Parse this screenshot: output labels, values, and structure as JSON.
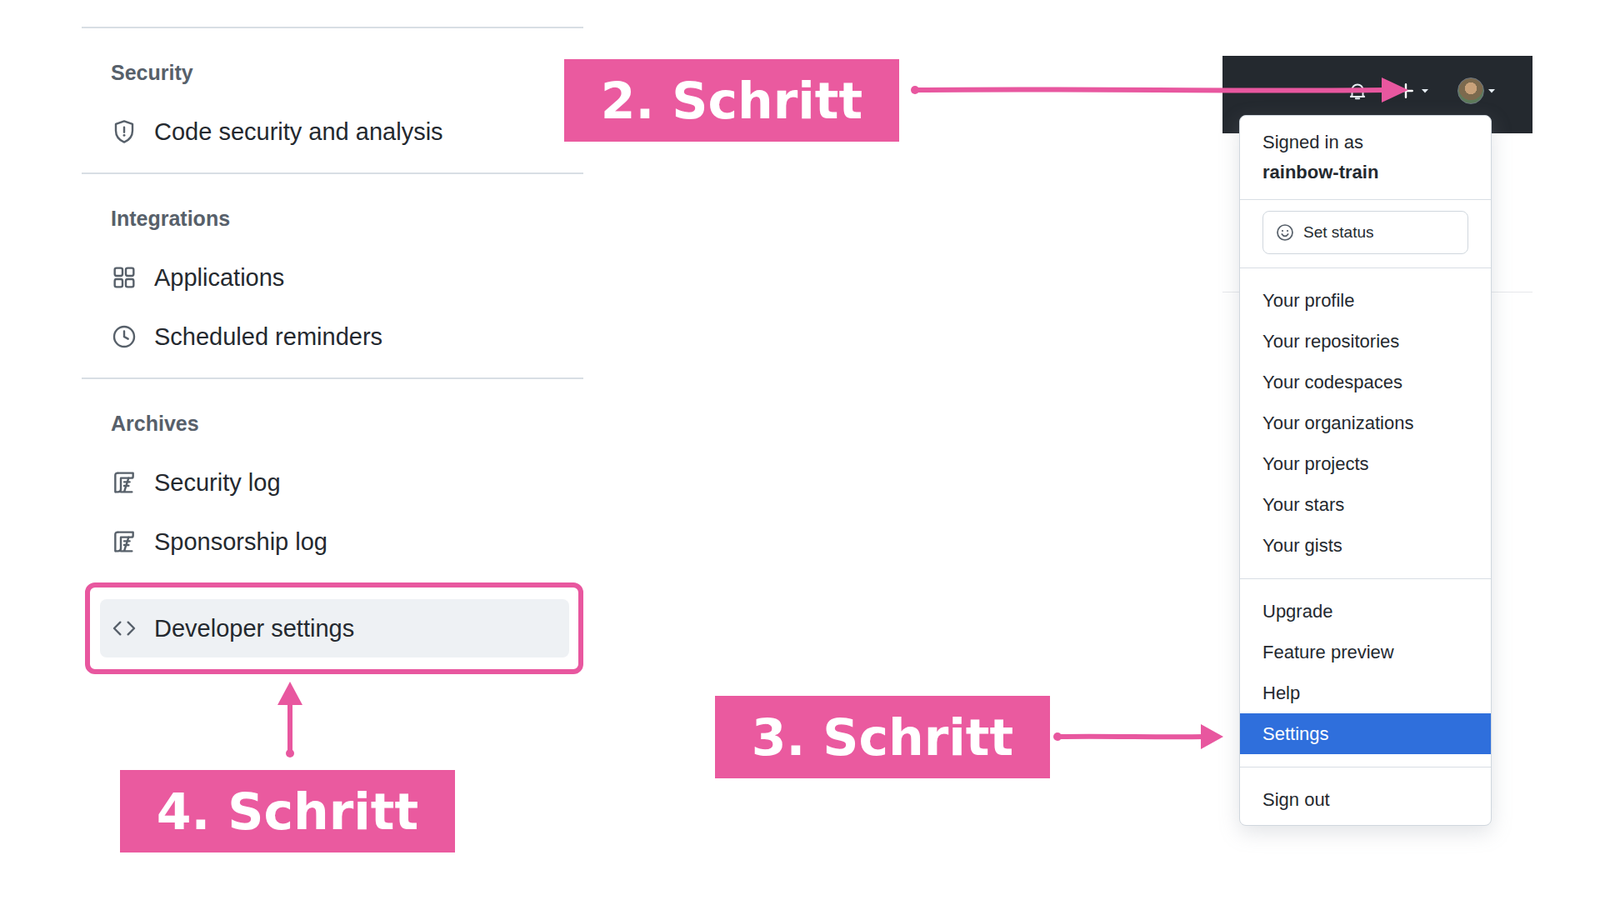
{
  "sidebar": {
    "sections": [
      {
        "heading": "Security",
        "items": [
          {
            "label": "Code security and analysis",
            "selected": false
          }
        ]
      },
      {
        "heading": "Integrations",
        "items": [
          {
            "label": "Applications",
            "selected": false
          },
          {
            "label": "Scheduled reminders",
            "selected": false
          }
        ]
      },
      {
        "heading": "Archives",
        "items": [
          {
            "label": "Security log",
            "selected": false
          },
          {
            "label": "Sponsorship log",
            "selected": false
          }
        ]
      }
    ],
    "footer_item": {
      "label": "Developer settings",
      "selected": true,
      "highlighted": true
    }
  },
  "account_menu": {
    "signed_in_label": "Signed in as",
    "username": "rainbow-train",
    "status_button": "Set status",
    "groups": [
      [
        {
          "label": "Your profile",
          "selected": false
        },
        {
          "label": "Your repositories",
          "selected": false
        },
        {
          "label": "Your codespaces",
          "selected": false
        },
        {
          "label": "Your organizations",
          "selected": false
        },
        {
          "label": "Your projects",
          "selected": false
        },
        {
          "label": "Your stars",
          "selected": false
        },
        {
          "label": "Your gists",
          "selected": false
        }
      ],
      [
        {
          "label": "Upgrade",
          "selected": false
        },
        {
          "label": "Feature preview",
          "selected": false
        },
        {
          "label": "Help",
          "selected": false
        },
        {
          "label": "Settings",
          "selected": true
        }
      ],
      [
        {
          "label": "Sign out",
          "selected": false
        }
      ]
    ]
  },
  "annotations": [
    {
      "label": "2. Schritt"
    },
    {
      "label": "3. Schritt"
    },
    {
      "label": "4. Schritt"
    }
  ]
}
